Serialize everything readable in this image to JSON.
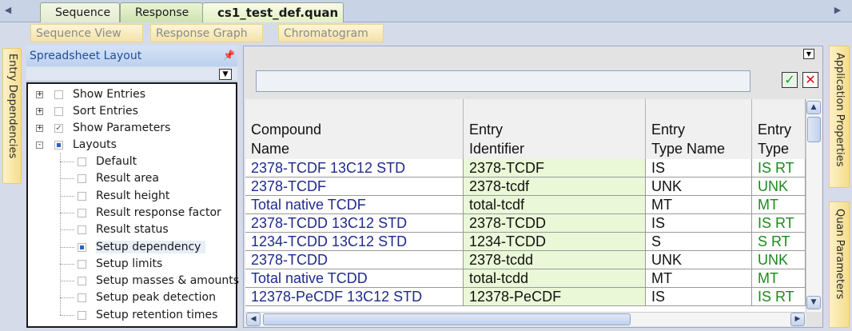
{
  "tabs": {
    "sequence": "Sequence",
    "response": "Response",
    "file": "cs1_test_def.quan"
  },
  "views": {
    "sequence_view": "Sequence View",
    "response_graph": "Response Graph",
    "chromatogram": "Chromatogram"
  },
  "side": {
    "left": "Entry Dependencies",
    "right_top": "Application Properties",
    "right_bottom": "Quan Parameters"
  },
  "panel": {
    "title": "Spreadsheet Layout",
    "pin_icon": "pin-icon",
    "items": [
      {
        "label": "Show Entries",
        "checked": "none",
        "expander": "+"
      },
      {
        "label": "Sort Entries",
        "checked": "none",
        "expander": "+"
      },
      {
        "label": "Show Parameters",
        "checked": "check",
        "expander": "+"
      },
      {
        "label": "Layouts",
        "checked": "indeterminate",
        "expander": "-"
      }
    ],
    "layouts": [
      {
        "label": "Default",
        "checked": "none"
      },
      {
        "label": "Result area",
        "checked": "none"
      },
      {
        "label": "Result height",
        "checked": "none"
      },
      {
        "label": "Result response factor",
        "checked": "none"
      },
      {
        "label": "Result status",
        "checked": "none"
      },
      {
        "label": "Setup dependency",
        "checked": "indeterminate"
      },
      {
        "label": "Setup limits",
        "checked": "none"
      },
      {
        "label": "Setup masses & amounts",
        "checked": "none"
      },
      {
        "label": "Setup peak detection",
        "checked": "none"
      },
      {
        "label": "Setup retention times",
        "checked": "none"
      }
    ]
  },
  "grid": {
    "formula_value": "",
    "accept_icon": "check-icon",
    "reject_icon": "x-icon",
    "columns": [
      {
        "line1": "Compound",
        "line2": "Name"
      },
      {
        "line1": "Entry",
        "line2": "Identifier"
      },
      {
        "line1": "Entry",
        "line2": "Type Name"
      },
      {
        "line1": "Entry",
        "line2": "Type"
      }
    ],
    "rows": [
      [
        "2378-TCDF 13C12 STD",
        "2378-TCDF",
        "IS",
        "IS RT"
      ],
      [
        "2378-TCDF",
        "2378-tcdf",
        "UNK",
        "UNK"
      ],
      [
        "Total native TCDF",
        "total-tcdf",
        "MT",
        "MT"
      ],
      [
        "2378-TCDD 13C12 STD",
        "2378-TCDD",
        "IS",
        "IS RT"
      ],
      [
        "1234-TCDD 13C12 STD",
        "1234-TCDD",
        "S",
        "S RT"
      ],
      [
        "2378-TCDD",
        "2378-tcdd",
        "UNK",
        "UNK"
      ],
      [
        "Total native TCDD",
        "total-tcdd",
        "MT",
        "MT"
      ],
      [
        "12378-PeCDF 13C12 STD",
        "12378-PeCDF",
        "IS",
        "IS RT"
      ]
    ]
  }
}
